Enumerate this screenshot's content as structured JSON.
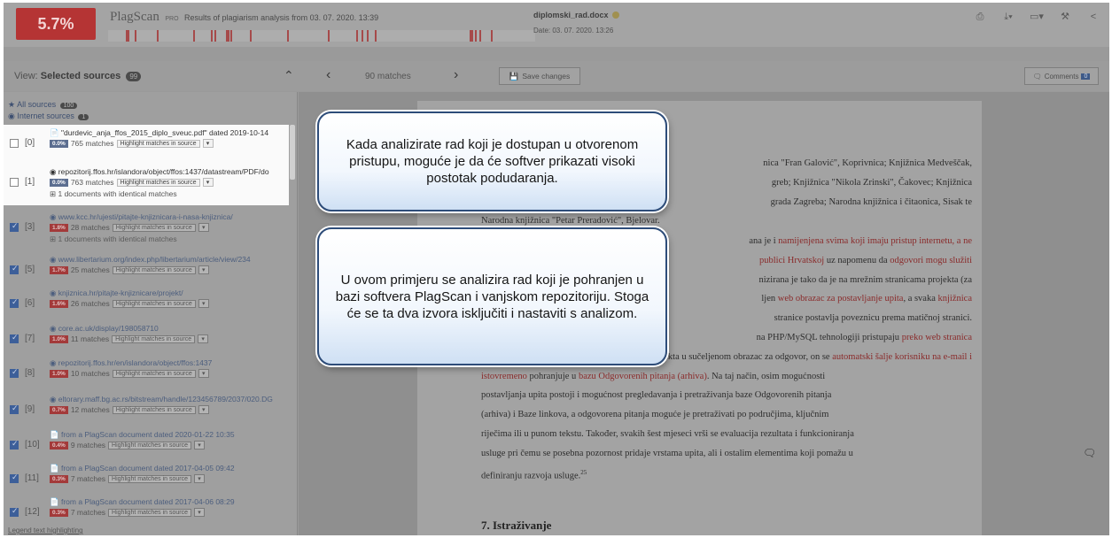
{
  "header": {
    "score": "5.7%",
    "brand": "PlagScan",
    "brand_tag": "PRO",
    "results_line": "Results of plagiarism analysis from 03. 07. 2020. 13:39",
    "document_name": "diplomski_rad.docx",
    "document_date": "Date: 03. 07. 2020. 13:26",
    "tools": [
      "print-icon",
      "download-icon",
      "display-icon",
      "settings-icon",
      "share-icon"
    ]
  },
  "viewbar": {
    "view_label": "View:",
    "view_value": "Selected sources",
    "view_count": "99",
    "matches": "90 matches",
    "save_changes": "Save changes",
    "comments": "Comments",
    "comments_count": "0"
  },
  "sidebar": {
    "all_sources": "All sources",
    "all_sources_count": "100",
    "internet_sources": "Internet sources",
    "internet_sources_count": "1",
    "highlight_label": "Highlight matches in source",
    "legend": "Legend text highlighting",
    "sources": [
      {
        "idx": "[0]",
        "checked": false,
        "title": "\"durdevic_anja_ffos_2015_diplo_sveuc.pdf\" dated 2019-10-14",
        "pct": "0.0%",
        "matches": "765 matches",
        "identical": ""
      },
      {
        "idx": "[1]",
        "checked": false,
        "title": "repozitorij.ffos.hr/islandora/object/ffos:1437/datastream/PDF/do",
        "pct": "0.0%",
        "matches": "763 matches",
        "identical": "1 documents with identical matches"
      },
      {
        "idx": "[3]",
        "checked": true,
        "title": "www.kcc.hr/ujesti/pitajte-knjiznicara-i-nasa-knjiznica/",
        "pct": "1.8%",
        "matches": "28 matches",
        "identical": "1 documents with identical matches"
      },
      {
        "idx": "[5]",
        "checked": true,
        "title": "www.libertarium.org/index.php/libertarium/article/view/234",
        "pct": "1.7%",
        "matches": "25 matches",
        "identical": ""
      },
      {
        "idx": "[6]",
        "checked": true,
        "title": "knjiznica.hr/pitajte-knjiznicare/projekt/",
        "pct": "1.6%",
        "matches": "26 matches",
        "identical": ""
      },
      {
        "idx": "[7]",
        "checked": true,
        "title": "core.ac.uk/display/198058710",
        "pct": "1.0%",
        "matches": "11 matches",
        "identical": ""
      },
      {
        "idx": "[8]",
        "checked": true,
        "title": "repozitorij.ffos.hr/en/islandora/object/ffos:1437",
        "pct": "1.0%",
        "matches": "10 matches",
        "identical": ""
      },
      {
        "idx": "[9]",
        "checked": true,
        "title": "eltorary.maff.bg.ac.rs/bitstream/handle/123456789/2037/020.DG",
        "pct": "0.7%",
        "matches": "12 matches",
        "identical": ""
      },
      {
        "idx": "[10]",
        "checked": true,
        "title": "from a PlagScan document dated 2020-01-22 10:35",
        "pct": "0.4%",
        "matches": "9 matches",
        "identical": ""
      },
      {
        "idx": "[11]",
        "checked": true,
        "title": "from a PlagScan document dated 2017-04-05 09:42",
        "pct": "0.3%",
        "matches": "7 matches",
        "identical": ""
      },
      {
        "idx": "[12]",
        "checked": true,
        "title": "from a PlagScan document dated 2017-04-06 08:29",
        "pct": "0.3%",
        "matches": "7 matches",
        "identical": ""
      }
    ]
  },
  "document": {
    "p1_l1": "nica \"Fran Galović\", Koprivnica; Knjižnica Medveščak,",
    "p1_l2": "greb; Knjižnica \"Nikola Zrinski\", Čakovec; Knjižnica",
    "p1_l3": "grada Zagreba; Narodna knjižnica i čitaonica, Sisak te",
    "p1_l4": "Narodna knjižnica \"Petar Preradović\", Bjelovar.",
    "p2_l1_a": "ana je i ",
    "p2_l1_b": "namijenjena svima koji imaju pristup internetu, a ne",
    "p2_l2_a": "publici Hrvatskoj",
    "p2_l2_b": " uz napomenu da ",
    "p2_l2_c": "odgovori mogu služiti",
    "p2_l3": "nizirana je tako da je na mrežnim stranicama projekta (za",
    "p2_l4_a": "ljen ",
    "p2_l4_b": "web obrazac za postavljanje upita",
    "p2_l4_c": ", a svaka ",
    "p2_l4_d": "knjižnica",
    "p2_l5": "stranice postavlja poveznicu prema matičnoj stranici.",
    "p2_l6_a": "na PHP/MySQL tehnologiji pristupaju ",
    "p2_l6_b": "preko web stranica",
    "p2_l7_a": "projekta u sučeljenom obrazac za odgovor, on se ",
    "p2_l7_b": "automatski šalje korisniku na e-mail i",
    "p2_l8_a": "istovremeno",
    "p2_l8_b": " pohranjuje u ",
    "p2_l8_c": "bazu Odgovorenih pitanja (arhiva)",
    "p2_l8_d": ". Na taj način, osim mogućnosti",
    "p2_l9": "postavljanja upita postoji i mogućnost pregledavanja i pretraživanja baze Odgovorenih pitanja",
    "p2_l10": "(arhiva) i Baze linkova, a odgovorena pitanja moguće je pretraživati po područjima, ključnim",
    "p2_l11": "riječima ili u punom tekstu. Također, svakih šest mjeseci vrši se evaluacija rezultata i funkcioniranja",
    "p2_l12": "usluge pri čemu se posebna pozornost pridaje vrstama upita, ali i ostalim elementima koji pomažu u",
    "p2_l13": "definiranju razvoja usluge.",
    "footnote": "25",
    "heading": "7. Istraživanje"
  },
  "callouts": {
    "first": "Kada analizirate rad koji je dostupan u otvorenom pristupu, moguće je da će softver prikazati visoki postotak podudaranja.",
    "second": "U ovom primjeru se analizira rad koji je pohranjen u bazi softvera PlagScan i vanjskom repozitoriju. Stoga će se ta dva izvora isključiti i nastaviti s analizom."
  }
}
